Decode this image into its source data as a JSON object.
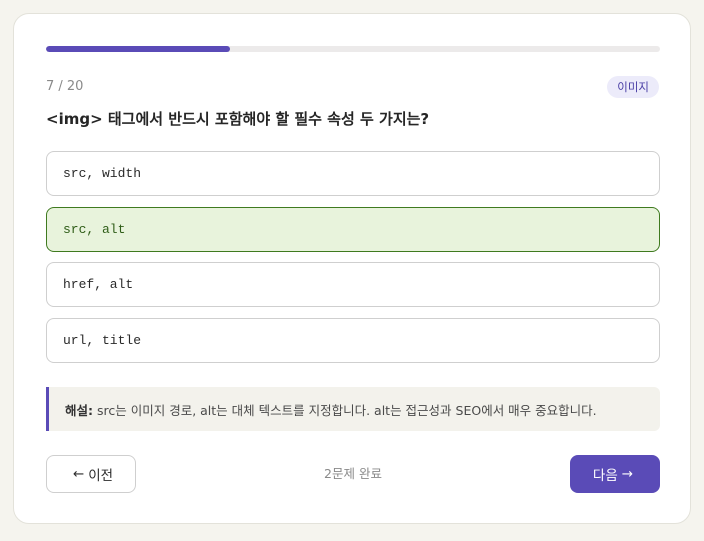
{
  "progress": {
    "current": 7,
    "total": 20,
    "fraction": 0.3
  },
  "header": {
    "counter": "7 / 20",
    "category": "이미지"
  },
  "question": {
    "text": "<img> 태그에서 반드시 포함해야 할 필수 속성 두 가지는?"
  },
  "options": [
    {
      "label": "src, width",
      "state": "default"
    },
    {
      "label": "src, alt",
      "state": "correct"
    },
    {
      "label": "href, alt",
      "state": "default"
    },
    {
      "label": "url, title",
      "state": "default"
    }
  ],
  "explanation": {
    "label": "해설:",
    "text": "src는 이미지 경로, alt는 대체 텍스트를 지정합니다. alt는 접근성과 SEO에서 매우 중요합니다."
  },
  "footer": {
    "prev_arrow": "←",
    "prev_label": "이전",
    "status": "2문제 완료",
    "next_label": "다음",
    "next_arrow": "→"
  },
  "colors": {
    "accent": "#5a4bb7",
    "correct_bg": "#e8f3dc",
    "correct_border": "#3f7a1f"
  }
}
